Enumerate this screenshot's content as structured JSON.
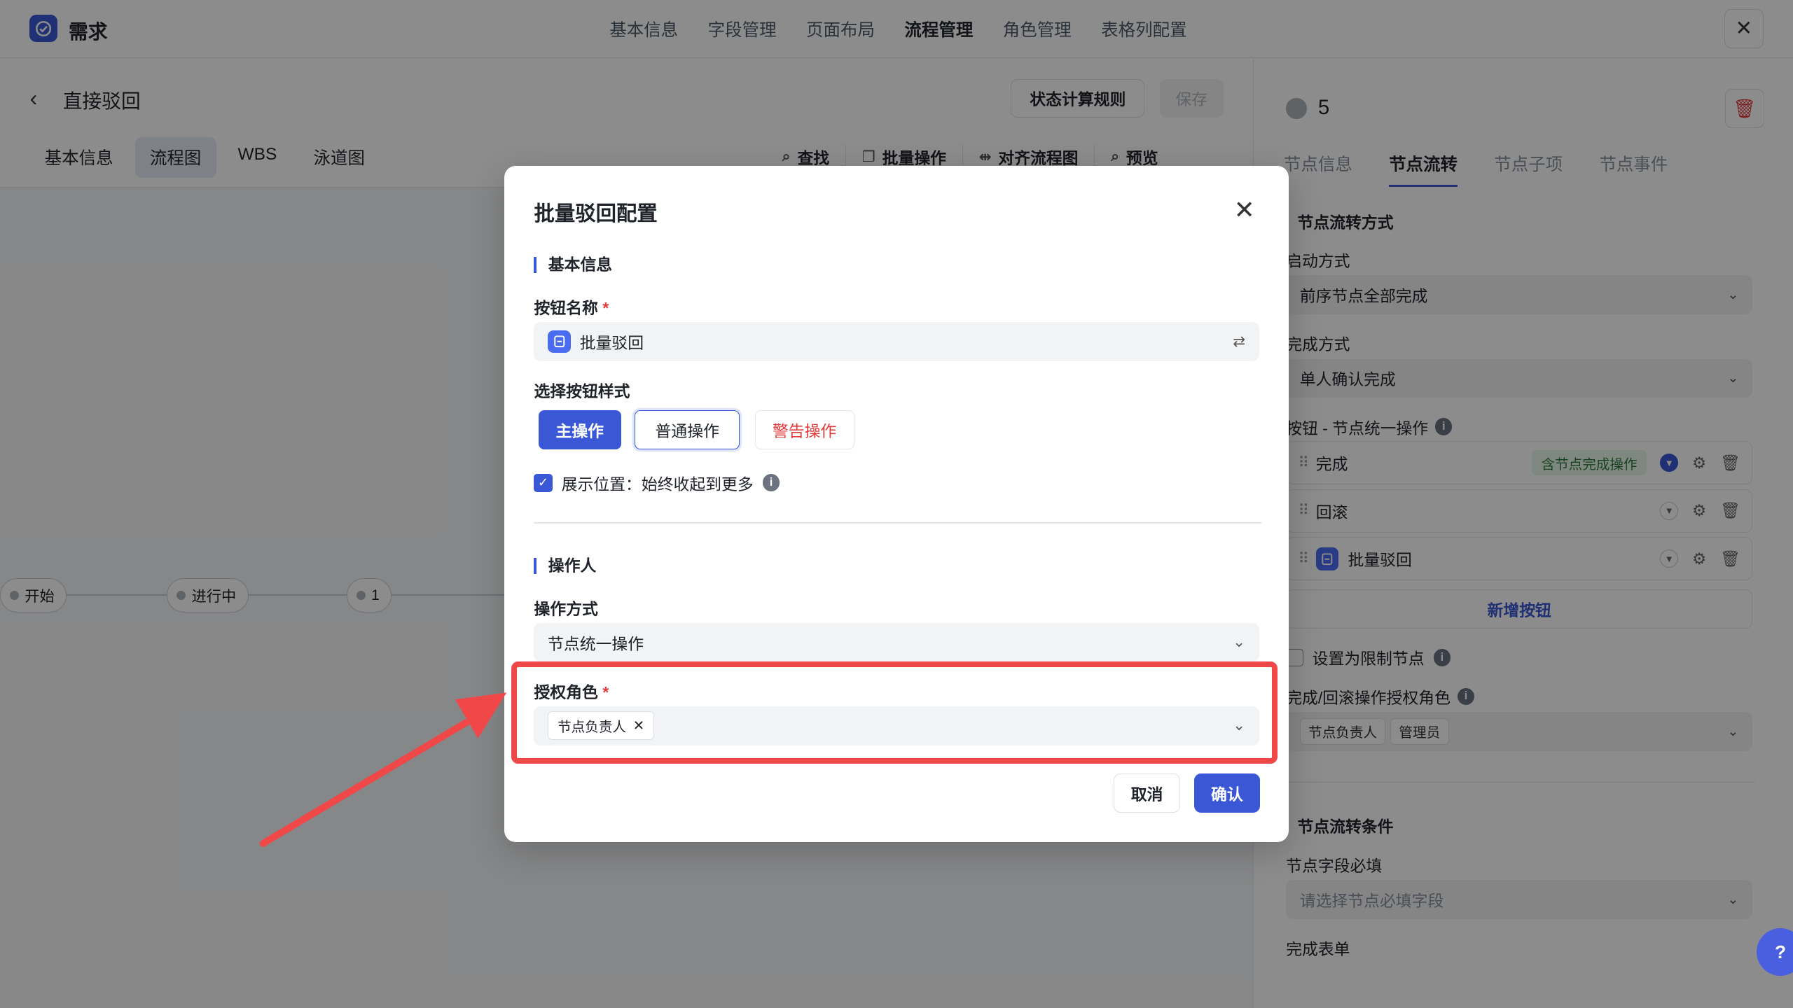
{
  "app": {
    "title": "需求"
  },
  "top_tabs": [
    "基本信息",
    "字段管理",
    "页面布局",
    "流程管理",
    "角色管理",
    "表格列配置"
  ],
  "top_tab_active": "流程管理",
  "page": {
    "title": "直接驳回",
    "state_rule_button": "状态计算规则",
    "save_button": "保存"
  },
  "sub_tabs": [
    "基本信息",
    "流程图",
    "WBS",
    "泳道图"
  ],
  "sub_tab_active": "流程图",
  "toolbar": [
    "查找",
    "批量操作",
    "对齐流程图",
    "预览"
  ],
  "flow_nodes": [
    "开始",
    "进行中",
    "1"
  ],
  "right_panel": {
    "node_number": "5",
    "tabs": [
      "节点信息",
      "节点流转",
      "节点子项",
      "节点事件"
    ],
    "active_tab": "节点流转",
    "section_flow_mode": "节点流转方式",
    "start_label": "启动方式",
    "start_value": "前序节点全部完成",
    "complete_label": "完成方式",
    "complete_value": "单人确认完成",
    "buttons_label": "按钮 - 节点统一操作",
    "button_rows": [
      {
        "name": "完成",
        "tag": "含节点完成操作"
      },
      {
        "name": "回滚",
        "tag": ""
      },
      {
        "name": "批量驳回",
        "tag": ""
      }
    ],
    "add_button": "新增按钮",
    "restrict_node_label": "设置为限制节点",
    "auth_roles_label": "完成/回滚操作授权角色",
    "auth_roles": [
      "节点负责人",
      "管理员"
    ],
    "section_conditions": "节点流转条件",
    "required_fields_label": "节点字段必填",
    "required_fields_placeholder": "请选择节点必填字段",
    "complete_form_label": "完成表单"
  },
  "dialog": {
    "title": "批量驳回配置",
    "section_basic": "基本信息",
    "button_name_label": "按钮名称",
    "button_name_value": "批量驳回",
    "style_label": "选择按钮样式",
    "style_options": [
      "主操作",
      "普通操作",
      "警告操作"
    ],
    "show_position": "展示位置：始终收起到更多",
    "section_operator": "操作人",
    "op_mode_label": "操作方式",
    "op_mode_value": "节点统一操作",
    "auth_role_label": "授权角色",
    "auth_role_chip": "节点负责人",
    "cancel": "取消",
    "confirm": "确认"
  },
  "colors": {
    "accent": "#3a58d6",
    "danger": "#e23b3b",
    "highlight": "#f04848"
  }
}
